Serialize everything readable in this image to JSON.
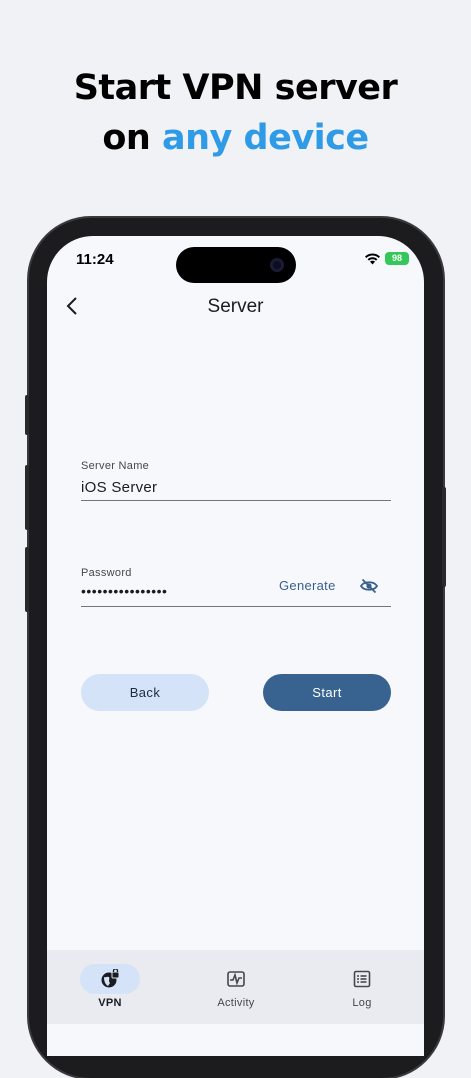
{
  "headline": {
    "line1": "Start VPN server",
    "line2_prefix": "on ",
    "line2_accent": "any device",
    "accent_color": "#2f9be6"
  },
  "status_bar": {
    "time": "11:24",
    "battery": "98"
  },
  "app_bar": {
    "title": "Server",
    "back_icon": "chevron-left-icon"
  },
  "form": {
    "server_name": {
      "label": "Server Name",
      "value": "iOS Server"
    },
    "password": {
      "label": "Password",
      "value": "••••••••••••••••",
      "generate_label": "Generate",
      "visibility_icon": "eye-off-icon"
    }
  },
  "actions": {
    "back_label": "Back",
    "start_label": "Start",
    "primary_color": "#386390",
    "secondary_color": "#d4e3f8"
  },
  "bottom_nav": {
    "items": [
      {
        "label": "VPN",
        "icon": "globe-lock-icon",
        "active": true
      },
      {
        "label": "Activity",
        "icon": "activity-icon",
        "active": false
      },
      {
        "label": "Log",
        "icon": "list-icon",
        "active": false
      }
    ]
  }
}
